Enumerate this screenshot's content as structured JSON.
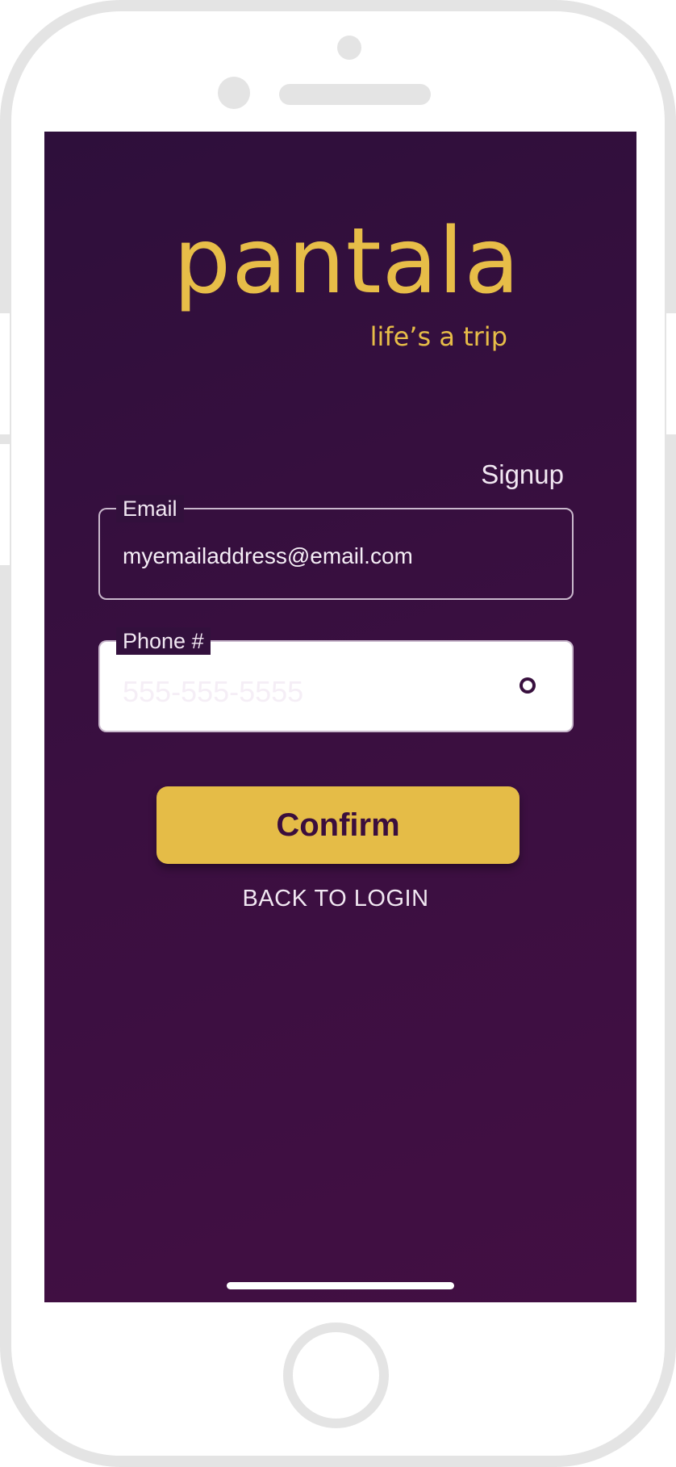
{
  "app": {
    "logo_text": "pantala",
    "tagline": "life’s a trip"
  },
  "header": {
    "mode_label": "Signup"
  },
  "form": {
    "email": {
      "label": "Email",
      "value": "myemailaddress@email.com"
    },
    "phone": {
      "label": "Phone #",
      "value": "555-555-5555",
      "visibility_icon": "eye-icon"
    },
    "confirm_label": "Confirm",
    "back_label": "BACK TO LOGIN"
  },
  "colors": {
    "background": "#3a0f40",
    "accent": "#e5bc47",
    "text": "#f1e7f2"
  }
}
